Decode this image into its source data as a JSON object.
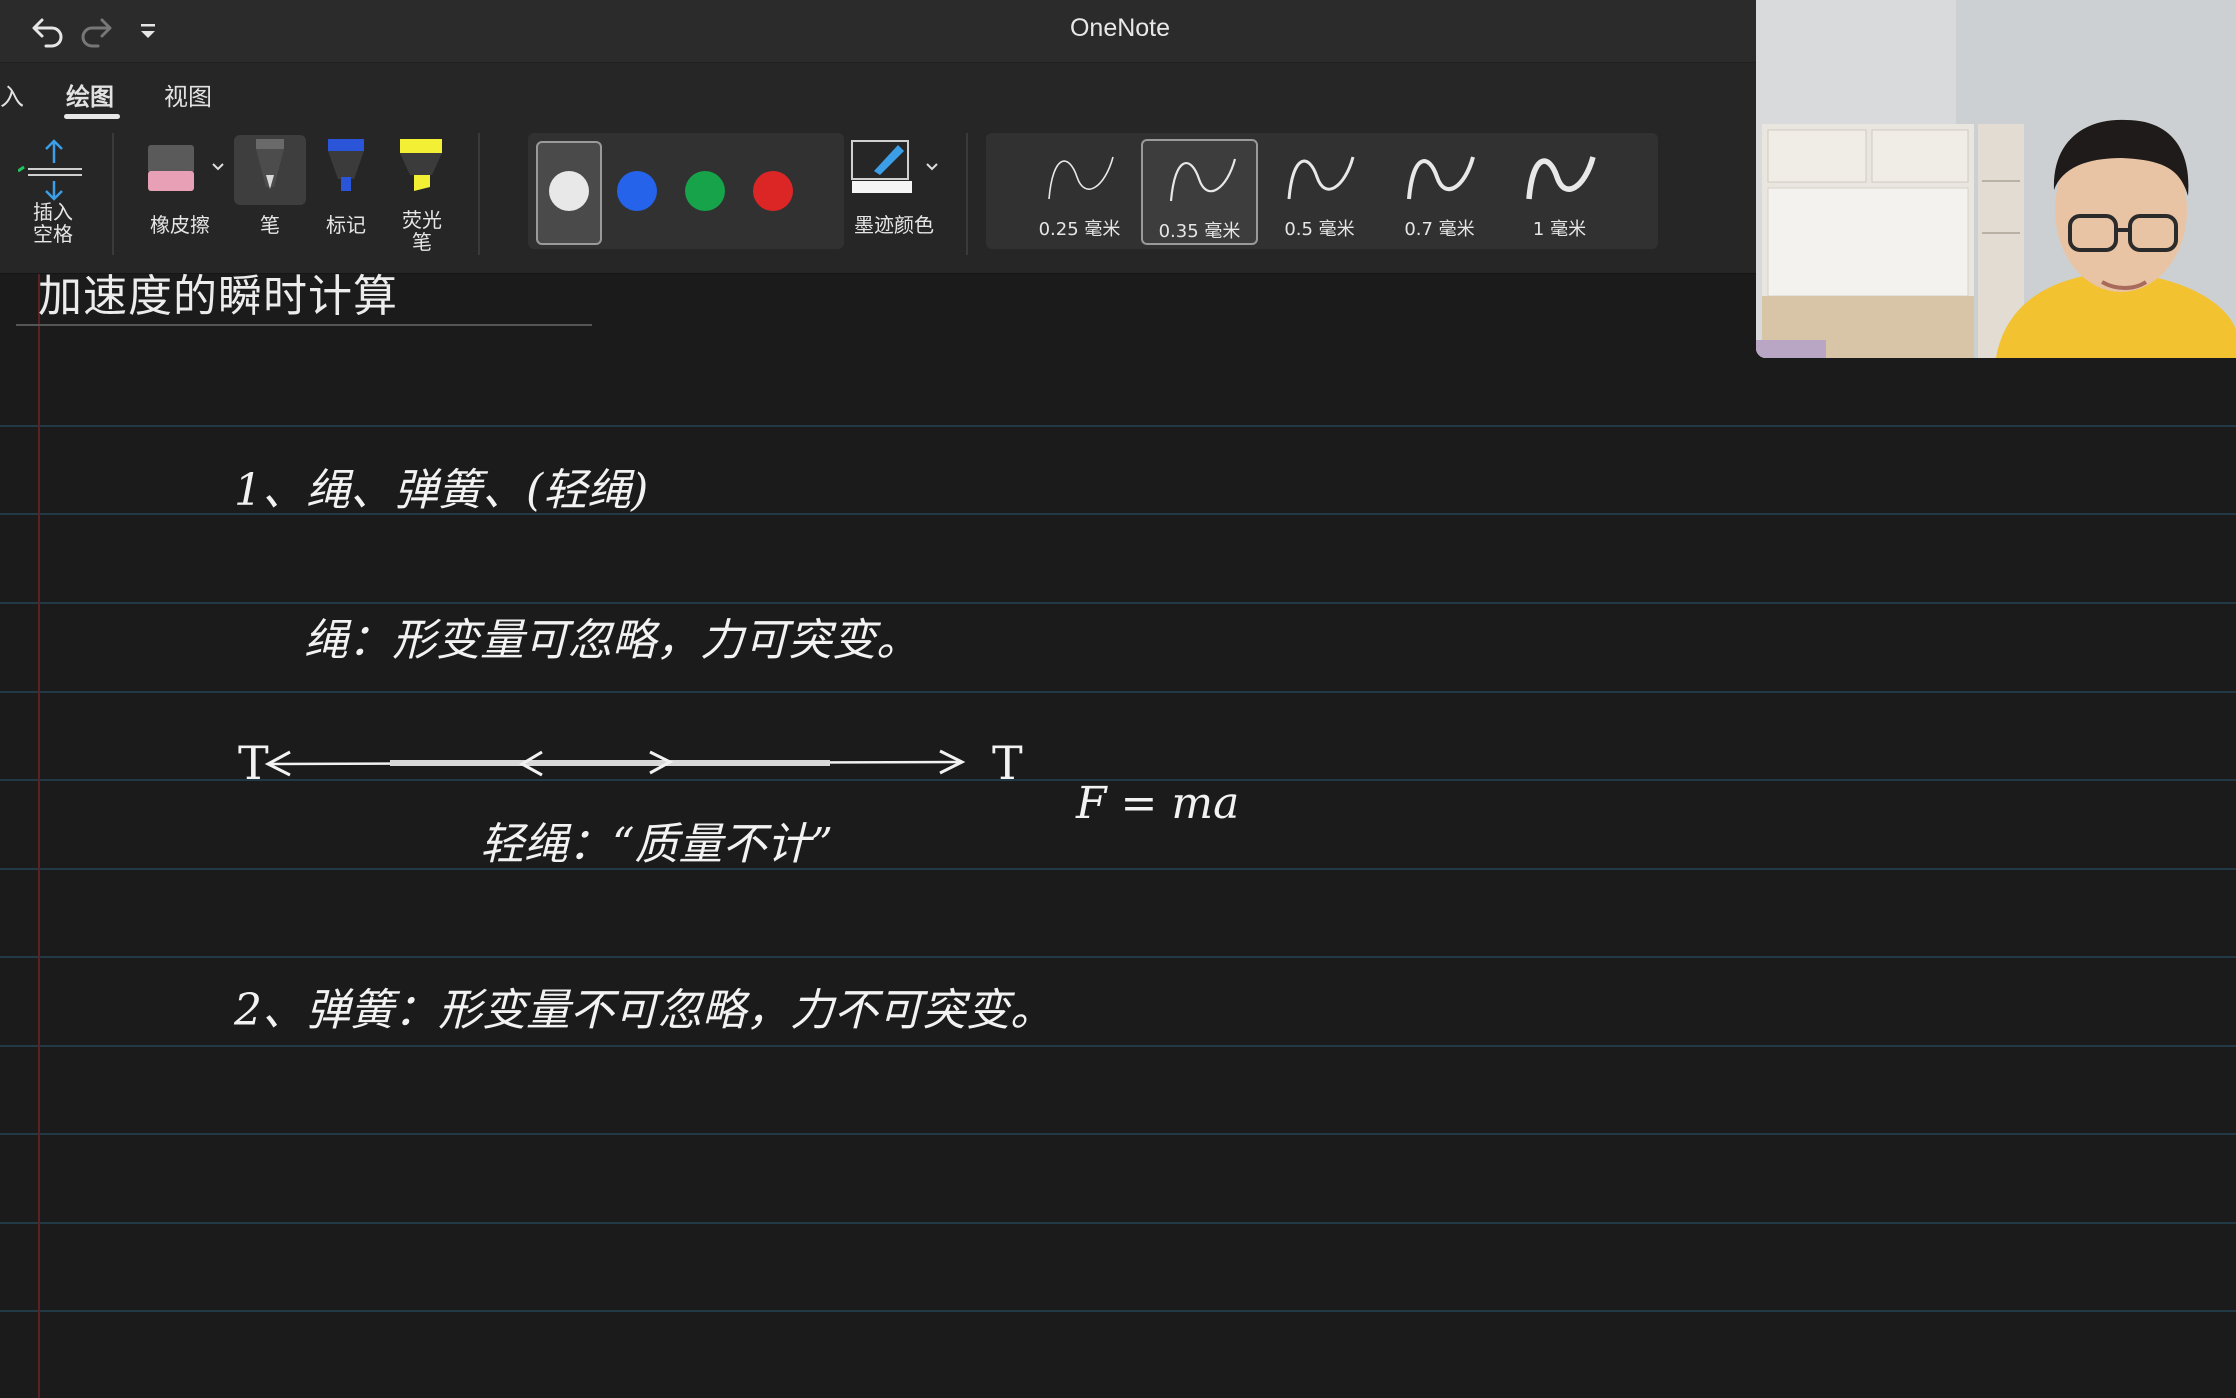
{
  "app": {
    "title": "OneNote"
  },
  "ribbon": {
    "tabs": [
      {
        "label": "入"
      },
      {
        "label": "绘图",
        "active": true
      },
      {
        "label": "视图"
      }
    ],
    "tools": {
      "insert_space": "插入\n空格",
      "eraser": "橡皮擦",
      "pen": "笔",
      "marker": "标记",
      "highlighter": "荧光\n笔",
      "ink_color": "墨迹颜色"
    },
    "pen_colors": [
      "#e8e8e8",
      "#2563eb",
      "#16a34a",
      "#dc2626"
    ],
    "stroke_widths": [
      {
        "label": "0.25 毫米",
        "selected": false
      },
      {
        "label": "0.35 毫米",
        "selected": true
      },
      {
        "label": "0.5 毫米",
        "selected": false
      },
      {
        "label": "0.7 毫米",
        "selected": false
      },
      {
        "label": "1 毫米",
        "selected": false
      }
    ]
  },
  "page": {
    "title": "加速度的瞬时计算",
    "notes": {
      "line1": "1、绳、弹簧、(轻绳)",
      "line2": "绳：形变量可忽略，力可突变。",
      "tension_left": "T",
      "tension_right": "T",
      "line3": "轻绳：“质量不计”",
      "formula": "F = ma",
      "line4": "2、弹簧：形变量不可忽略，力不可突变。"
    }
  }
}
